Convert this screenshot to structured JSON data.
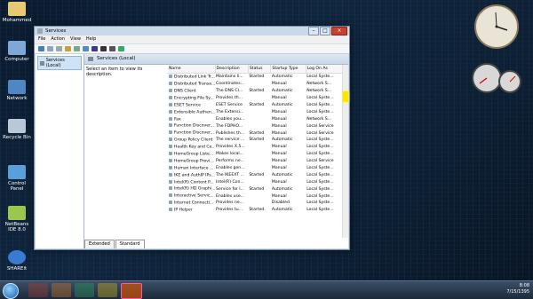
{
  "desktop": {
    "icons": [
      {
        "label": "Mohammed"
      },
      {
        "label": "Computer"
      },
      {
        "label": "Network"
      },
      {
        "label": "Recycle Bin"
      },
      {
        "label": "Control Panel"
      },
      {
        "label": "NetBeans IDE 8.0"
      },
      {
        "label": "SHAREit"
      }
    ]
  },
  "window": {
    "title": "Services",
    "menu": [
      "File",
      "Action",
      "View",
      "Help"
    ],
    "tree_root": "Services (Local)",
    "pane_title": "Services (Local)",
    "description": "Select an item to view its description.",
    "columns": [
      "Name",
      "Description",
      "Status",
      "Startup Type",
      "Log On As"
    ],
    "rows": [
      [
        "Distributed Link Tr...",
        "Maintains li...",
        "Started",
        "Automatic",
        "Local Syste..."
      ],
      [
        "Distributed Transa...",
        "Coordinates...",
        "",
        "Manual",
        "Network S..."
      ],
      [
        "DNS Client",
        "The DNS Cl...",
        "Started",
        "Automatic",
        "Network S..."
      ],
      [
        "Encrypting File Sy...",
        "Provides th...",
        "",
        "Manual",
        "Local Syste..."
      ],
      [
        "ESET Service",
        "ESET Service",
        "Started",
        "Automatic",
        "Local Syste..."
      ],
      [
        "Extensible Authen...",
        "The Extensi...",
        "",
        "Manual",
        "Local Syste..."
      ],
      [
        "Fax",
        "Enables you...",
        "",
        "Manual",
        "Network S..."
      ],
      [
        "Function Discover...",
        "The FDPHO...",
        "",
        "Manual",
        "Local Service"
      ],
      [
        "Function Discover...",
        "Publishes th...",
        "Started",
        "Manual",
        "Local Service"
      ],
      [
        "Group Policy Client",
        "The service ...",
        "Started",
        "Automatic",
        "Local Syste..."
      ],
      [
        "Health Key and Ce...",
        "Provides X.5...",
        "",
        "Manual",
        "Local Syste..."
      ],
      [
        "HomeGroup Liste...",
        "Makes local...",
        "",
        "Manual",
        "Local Syste..."
      ],
      [
        "HomeGroup Provi...",
        "Performs ne...",
        "",
        "Manual",
        "Local Service"
      ],
      [
        "Human Interface ...",
        "Enables gen...",
        "",
        "Manual",
        "Local Syste..."
      ],
      [
        "IKE and AuthIP IPs...",
        "The IKEEXT ...",
        "Started",
        "Automatic",
        "Local Syste..."
      ],
      [
        "Intel(R) Content P...",
        "Intel(R) Con...",
        "",
        "Manual",
        "Local Syste..."
      ],
      [
        "Intel(R) HD Graphi...",
        "Service for I...",
        "Started",
        "Automatic",
        "Local Syste..."
      ],
      [
        "Interactive Servic...",
        "Enables use...",
        "",
        "Manual",
        "Local Syste..."
      ],
      [
        "Internet Connecti...",
        "Provides ne...",
        "",
        "Disabled",
        "Local Syste..."
      ],
      [
        "IP Helper",
        "Provides tu...",
        "Started",
        "Automatic",
        "Local Syste..."
      ]
    ],
    "tabs": [
      "Extended",
      "Standard"
    ]
  },
  "tray": {
    "time": "8:08",
    "date": "7/15/1395"
  },
  "colors": {
    "scroll_highlight": "#ffe600",
    "close": "#c8412f"
  }
}
